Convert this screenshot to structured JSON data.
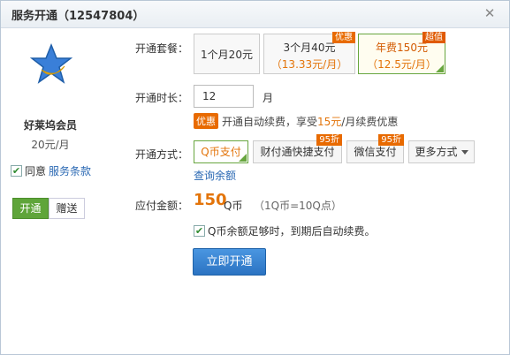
{
  "window": {
    "title": "服务开通（12547804）"
  },
  "sidebar": {
    "product_name": "好莱坞会员",
    "product_price": "20元/月",
    "agree_text": "同意",
    "agree_link": "服务条款",
    "agree_checked": true,
    "tabs": [
      {
        "label": "开通",
        "active": true
      },
      {
        "label": "赠送",
        "active": false
      }
    ]
  },
  "package": {
    "label": "开通套餐：",
    "options": [
      {
        "line1": "1个月20元",
        "line2": "",
        "tag": "",
        "selected": false
      },
      {
        "line1": "3个月40元",
        "line2": "（13.33元/月）",
        "tag": "优惠",
        "selected": false
      },
      {
        "line1": "年费150元",
        "line2": "（12.5元/月）",
        "tag": "超值",
        "selected": true
      }
    ]
  },
  "duration": {
    "label": "开通时长：",
    "value": "12",
    "unit": "月",
    "promo_badge": "优惠",
    "promo_before": "开通自动续费，享受",
    "promo_price": "15元",
    "promo_after": "/月续费优惠"
  },
  "payment": {
    "label": "开通方式：",
    "methods": [
      {
        "label": "Q币支付",
        "tag": "",
        "selected": true
      },
      {
        "label": "财付通快捷支付",
        "tag": "95折",
        "selected": false
      },
      {
        "label": "微信支付",
        "tag": "95折",
        "selected": false
      },
      {
        "label": "更多方式",
        "tag": "",
        "selected": false
      }
    ],
    "balance_link": "查询余额"
  },
  "amount": {
    "label": "应付金额：",
    "value": "150",
    "currency": "Q币",
    "rate": "（1Q币=10Q点）"
  },
  "auto_renew": {
    "checked": true,
    "text": "Q币余额足够时，到期后自动续费。"
  },
  "submit": {
    "label": "立即开通"
  },
  "colors": {
    "accent_green": "#5fa53a",
    "accent_orange": "#e3740a",
    "primary_blue": "#2b73c2",
    "link_blue": "#2a68b3"
  }
}
